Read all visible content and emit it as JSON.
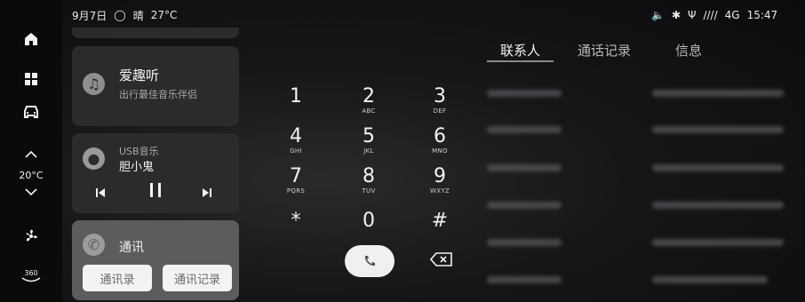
{
  "status": {
    "date": "9月7日",
    "weather": "晴",
    "temp": "27°C",
    "network": "4G",
    "signal": "////",
    "time": "15:47"
  },
  "rail": {
    "temp_label": "20°C",
    "ac_label": "360"
  },
  "music_card": {
    "title": "爱趣听",
    "subtitle": "出行最佳音乐伴侣"
  },
  "usb_card": {
    "source": "USB音乐",
    "song": "胆小鬼"
  },
  "comm_card": {
    "title": "通讯",
    "btn_contacts": "通讯录",
    "btn_calllog": "通讯记录"
  },
  "tabs": [
    {
      "label": "联系人",
      "active": true
    },
    {
      "label": "通话记录"
    },
    {
      "label": "信息"
    }
  ],
  "keypad": [
    {
      "d": "1",
      "l": ""
    },
    {
      "d": "2",
      "l": "ABC"
    },
    {
      "d": "3",
      "l": "DEF"
    },
    {
      "d": "4",
      "l": "GHI"
    },
    {
      "d": "5",
      "l": "JKL"
    },
    {
      "d": "6",
      "l": "MNO"
    },
    {
      "d": "7",
      "l": "PQRS"
    },
    {
      "d": "8",
      "l": "TUV"
    },
    {
      "d": "9",
      "l": "WXYZ"
    },
    {
      "d": "*",
      "l": ""
    },
    {
      "d": "0",
      "l": ""
    },
    {
      "d": "#",
      "l": ""
    }
  ],
  "colors": {
    "accent": "#f3f3f3",
    "card": "#2b2b2d",
    "active_card": "#5a5a5c"
  }
}
